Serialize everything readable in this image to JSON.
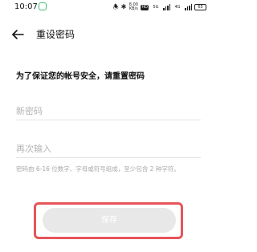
{
  "status_bar": {
    "time": "10:07",
    "net_speed": "8.00 KB/s",
    "hd_badge": "HD",
    "sim_1": "5G",
    "sim_2": "4G",
    "battery": "65"
  },
  "header": {
    "back_icon": "arrow-left-icon",
    "title": "重设密码"
  },
  "form": {
    "instruction": "为了保证您的帐号安全，请重置密码",
    "new_password": {
      "value": "",
      "placeholder": "新密码"
    },
    "confirm_password": {
      "value": "",
      "placeholder": "再次输入"
    },
    "hint": "密码由 6-16 位数字、字母或符号组成，至少包含 2 种字符。",
    "save_label": "保存",
    "accent_color": "#e5555a"
  }
}
